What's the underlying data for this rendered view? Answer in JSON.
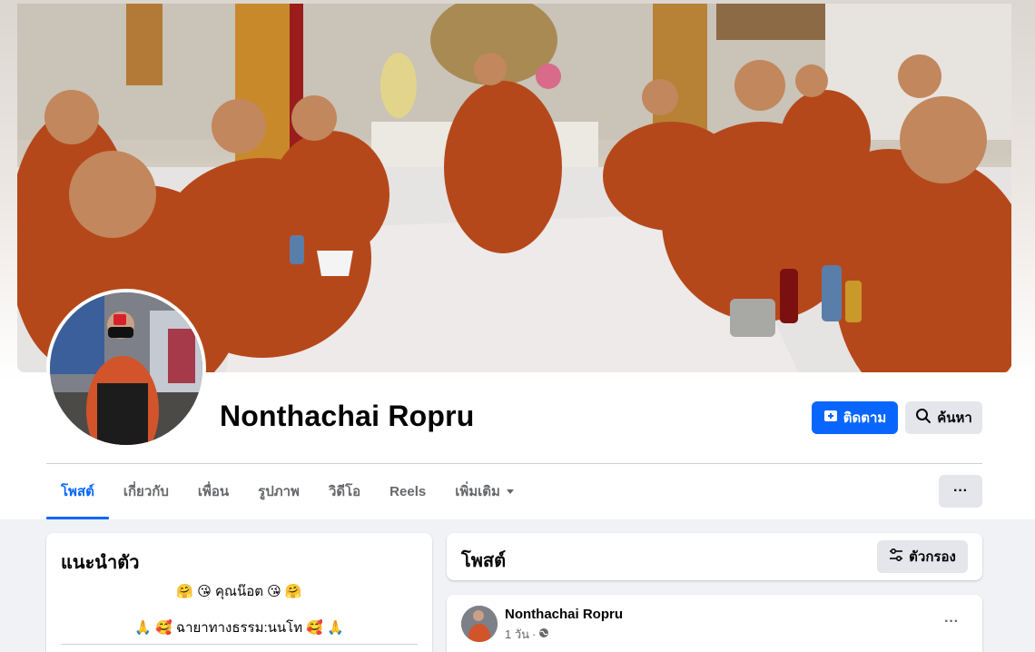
{
  "profile": {
    "name": "Nonthachai Ropru",
    "cover_alt": "cover-photo",
    "avatar_alt": "profile-picture"
  },
  "actions": {
    "follow_label": "ติดตาม",
    "search_label": "ค้นหา",
    "more_label": "···"
  },
  "tabs": [
    {
      "label": "โพสต์",
      "active": true
    },
    {
      "label": "เกี่ยวกับ",
      "active": false
    },
    {
      "label": "เพื่อน",
      "active": false
    },
    {
      "label": "รูปภาพ",
      "active": false
    },
    {
      "label": "วิดีโอ",
      "active": false
    },
    {
      "label": "Reels",
      "active": false
    },
    {
      "label": "เพิ่มเติม",
      "active": false
    }
  ],
  "intro": {
    "title": "แนะนำตัว",
    "bio_line1": "🤗 😘 คุณน๊อต 😘 🤗",
    "bio_line2": "🙏 🥰 ฉายาทางธรรม:นนโท 🥰 🙏"
  },
  "posts_section": {
    "title": "โพสต์",
    "filter_label": "ตัวกรอง"
  },
  "post": {
    "author": "Nonthachai Ropru",
    "time": "1 วัน",
    "separator": "·",
    "more_label": "···"
  },
  "colors": {
    "accent": "#0866ff",
    "secondary_button": "#e4e6eb",
    "page_bg": "#f0f2f5",
    "muted_text": "#65676b"
  },
  "icons": {
    "follow": "user-plus-icon",
    "search": "search-icon",
    "dropdown": "caret-down-icon",
    "filter": "sliders-icon",
    "privacy": "globe-icon"
  }
}
